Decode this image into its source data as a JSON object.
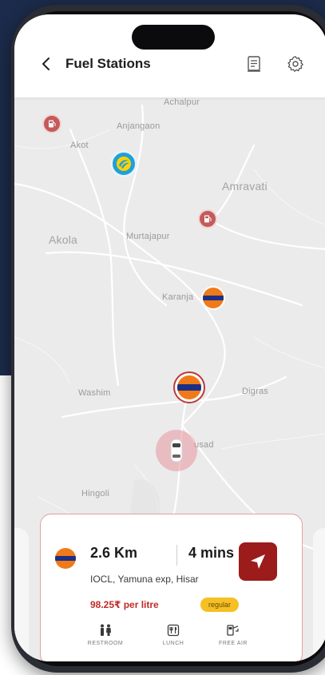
{
  "header": {
    "title": "Fuel Stations",
    "back_icon": "chevron-left-icon",
    "list_icon": "document-icon",
    "settings_icon": "gear-icon"
  },
  "map": {
    "places": [
      {
        "key": "achalpur",
        "label": "Achalpur"
      },
      {
        "key": "anjangaon",
        "label": "Anjangaon"
      },
      {
        "key": "akot",
        "label": "Akot"
      },
      {
        "key": "amravati",
        "label": "Amravati"
      },
      {
        "key": "akola",
        "label": "Akola"
      },
      {
        "key": "murtajapur",
        "label": "Murtajapur"
      },
      {
        "key": "karanja",
        "label": "Karanja"
      },
      {
        "key": "washim",
        "label": "Washim"
      },
      {
        "key": "digras",
        "label": "Digras"
      },
      {
        "key": "pusad",
        "label": "usad"
      },
      {
        "key": "hingoli",
        "label": "Hingoli"
      }
    ]
  },
  "card": {
    "distance": "2.6 Km",
    "duration": "4 mins",
    "address": "IOCL, Yamuna exp, Hisar",
    "price": "98.25₹ per litre",
    "fuel_type": "regular",
    "amenities": [
      {
        "label": "RESTROOM",
        "icon": "restroom-icon"
      },
      {
        "label": "LUNCH",
        "icon": "lunch-icon"
      },
      {
        "label": "FREE AIR",
        "icon": "air-pump-icon"
      }
    ]
  },
  "colors": {
    "accent": "#9c1b1b",
    "price": "#c22a2a",
    "badge": "#f4c024",
    "background_navy": "#1c2b4b"
  }
}
